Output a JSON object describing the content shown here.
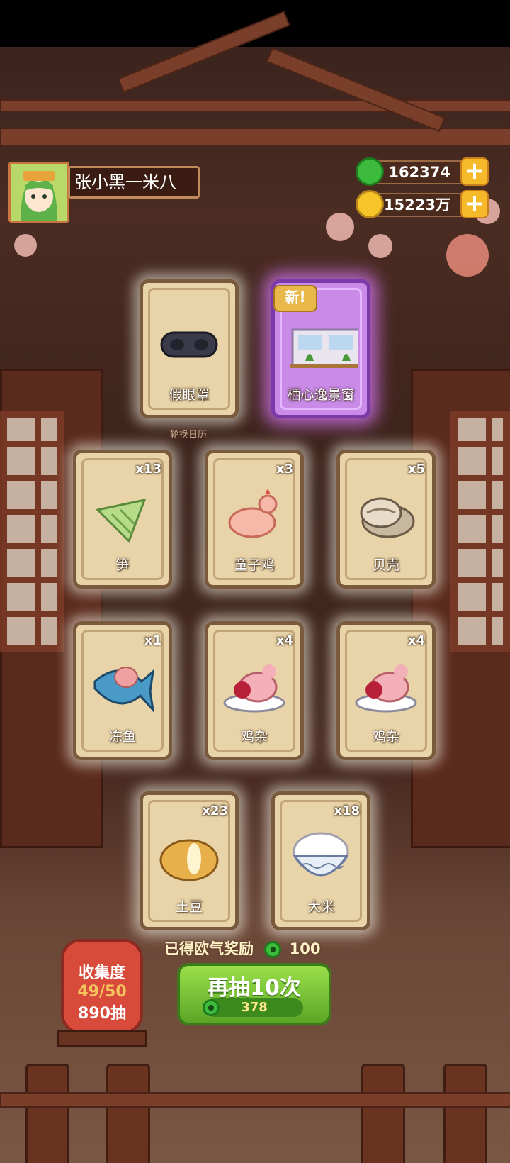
{
  "player": {
    "name": "张小黑一米八"
  },
  "currency": {
    "jade": "162374",
    "coins": "15223万"
  },
  "featured_cards": [
    {
      "label": "假眼罩",
      "item": "eye-mask"
    },
    {
      "label": "栖心逸景窗",
      "badge": "新",
      "item": "scenic-window"
    }
  ],
  "calendar_label": "轮换日历",
  "cards": [
    {
      "label": "笋",
      "count": "x13"
    },
    {
      "label": "童子鸡",
      "count": "x3"
    },
    {
      "label": "贝壳",
      "count": "x5"
    },
    {
      "label": "冻鱼",
      "count": "x1"
    },
    {
      "label": "鸡杂",
      "count": "x4"
    },
    {
      "label": "鸡杂",
      "count": "x4"
    },
    {
      "label": "土豆",
      "count": "x23"
    },
    {
      "label": "大米",
      "count": "x18"
    }
  ],
  "collection": {
    "title": "收集度",
    "progress": "49/50",
    "draws": "890抽"
  },
  "reward": {
    "label": "已得欧气奖励",
    "value": "100"
  },
  "draw_button": {
    "label": "再抽10次",
    "cost": "378"
  },
  "colors": {
    "jade": "#3dbb3d",
    "button_green": "#5aa626",
    "card_parchment": "#e8d4a8",
    "new_card_glow": "#c98ae8"
  }
}
